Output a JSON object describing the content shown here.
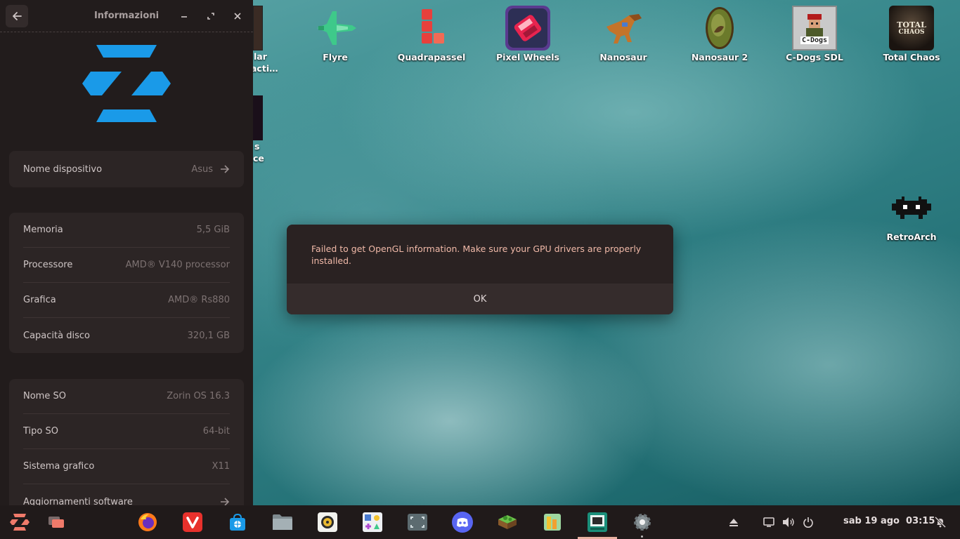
{
  "desktop": {
    "partial_labels": [
      "lar",
      "acti…",
      "s",
      "ce"
    ],
    "icons": [
      {
        "label": "Flyre",
        "icon": "jet-icon"
      },
      {
        "label": "Quadrapassel",
        "icon": "blocks-icon"
      },
      {
        "label": "Pixel Wheels",
        "icon": "car-icon"
      },
      {
        "label": "Nanosaur",
        "icon": "dinosaur-icon"
      },
      {
        "label": "Nanosaur 2",
        "icon": "egg-icon"
      },
      {
        "label": "C-Dogs SDL",
        "icon": "soldier-icon"
      },
      {
        "label": "Total Chaos",
        "icon": "horror-icon"
      },
      {
        "label": "RetroArch",
        "icon": "invader-icon"
      }
    ],
    "cdogs_icon_text": "C-Dogs",
    "totalchaos_icon_text": [
      "TOTAL",
      "CHAOS"
    ]
  },
  "settings": {
    "title": "Informazioni",
    "device_group": [
      {
        "key": "Nome dispositivo",
        "value": "Asus",
        "arrow": true
      }
    ],
    "hardware_group": [
      {
        "key": "Memoria",
        "value": "5,5 GiB"
      },
      {
        "key": "Processore",
        "value": "AMD® V140 processor"
      },
      {
        "key": "Grafica",
        "value": "AMD® Rs880"
      },
      {
        "key": "Capacità disco",
        "value": "320,1 GB"
      }
    ],
    "os_group": [
      {
        "key": "Nome SO",
        "value": "Zorin OS 16.3"
      },
      {
        "key": "Tipo SO",
        "value": "64-bit"
      },
      {
        "key": "Sistema grafico",
        "value": "X11"
      },
      {
        "key": "Aggiornamenti software",
        "value": "",
        "arrow": true
      }
    ]
  },
  "dialog": {
    "message": "Failed to get OpenGL information. Make sure your GPU drivers are properly installed.",
    "ok_label": "OK"
  },
  "taskbar": {
    "clock": "sab 19 ago  03:15",
    "apps": [
      "zorin-menu-icon",
      "workspaces-icon",
      "firefox-icon",
      "vivaldi-icon",
      "software-store-icon",
      "files-icon",
      "rhythmbox-icon",
      "games-icon",
      "screenshot-icon",
      "discord-icon",
      "map-icon",
      "lutris-icon",
      "app-icon",
      "settings-icon"
    ]
  },
  "colors": {
    "zorin_blue": "#1a9ae8",
    "dialog_text": "#f0b9a8",
    "active_indicator": "#e8b0a0"
  }
}
